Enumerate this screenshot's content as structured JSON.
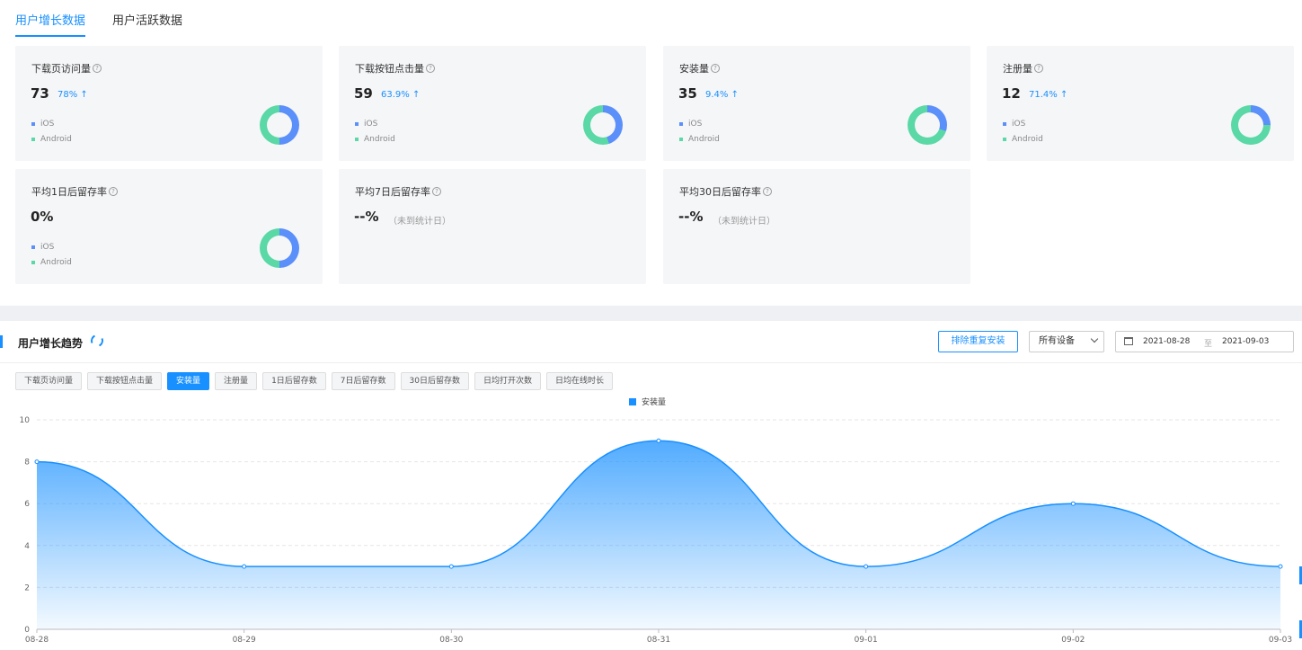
{
  "tabs": [
    {
      "label": "用户增长数据",
      "active": true
    },
    {
      "label": "用户活跃数据",
      "active": false
    }
  ],
  "legend": {
    "ios": "iOS",
    "android": "Android",
    "ios_color": "#5b8ff9",
    "android_color": "#5ad8a6"
  },
  "cards": [
    {
      "title": "下载页访问量",
      "value": "73",
      "pct": "78%",
      "trend": "up",
      "ios_share": 0.5
    },
    {
      "title": "下载按钮点击量",
      "value": "59",
      "pct": "63.9%",
      "trend": "up",
      "ios_share": 0.45
    },
    {
      "title": "安装量",
      "value": "35",
      "pct": "9.4%",
      "trend": "up",
      "ios_share": 0.3
    },
    {
      "title": "注册量",
      "value": "12",
      "pct": "71.4%",
      "trend": "up",
      "ios_share": 0.25
    },
    {
      "title": "平均1日后留存率",
      "value": "0%",
      "ios_share": 0.5
    },
    {
      "title": "平均7日后留存率",
      "value": "--%",
      "note": "（未到统计日）"
    },
    {
      "title": "平均30日后留存率",
      "value": "--%",
      "note": "（未到统计日）"
    }
  ],
  "trend": {
    "title": "用户增长趋势",
    "exclude_button": "排除重复安装",
    "device_select": "所有设备",
    "date_start": "2021-08-28",
    "date_sep": "至",
    "date_end": "2021-09-03",
    "metric_tabs": [
      {
        "label": "下载页访问量",
        "active": false
      },
      {
        "label": "下载按钮点击量",
        "active": false
      },
      {
        "label": "安装量",
        "active": true
      },
      {
        "label": "注册量",
        "active": false
      },
      {
        "label": "1日后留存数",
        "active": false
      },
      {
        "label": "7日后留存数",
        "active": false
      },
      {
        "label": "30日后留存数",
        "active": false
      },
      {
        "label": "日均打开次数",
        "active": false
      },
      {
        "label": "日均在线时长",
        "active": false
      }
    ]
  },
  "chart_data": {
    "type": "area",
    "x": [
      "08-28",
      "08-29",
      "08-30",
      "08-31",
      "09-01",
      "09-02",
      "09-03"
    ],
    "series": [
      {
        "name": "安装量",
        "values": [
          8,
          3,
          3,
          9,
          3,
          6,
          3
        ]
      }
    ],
    "yticks": [
      "0",
      "2",
      "4",
      "6",
      "8",
      "10"
    ],
    "ylim": [
      0,
      10
    ],
    "legend_position": "top-center",
    "grid": true,
    "color": "#1890ff"
  }
}
